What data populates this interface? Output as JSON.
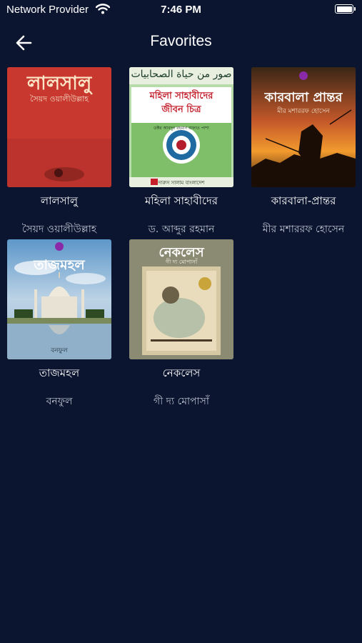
{
  "status_bar": {
    "carrier": "Network Provider",
    "time": "7:46 PM"
  },
  "header": {
    "title": "Favorites"
  },
  "books": [
    {
      "title": "লালসালু",
      "author": "সৈয়দ ওয়ালীউল্লাহ",
      "cover": {
        "title": "লালসালু",
        "subtitle": "সৈয়দ ওয়ালীউল্লাহ"
      }
    },
    {
      "title": "মহিলা সাহাবীদের",
      "author": "ড. আব্দুর রহমান",
      "cover": {
        "arabic": "صور من حياة الصحابيات",
        "title_line1": "মহিলা সাহাবীদের",
        "title_line2": "জীবন চিত্র",
        "author_line": "ডক্টর আবদুর রহমান রাফাত পাশা",
        "publisher": "দারুস সালাম বাংলাদেশ"
      }
    },
    {
      "title": "কারবালা-প্রান্তর",
      "author": "মীর মশাররফ হোসেন",
      "cover": {
        "title": "কারবালা প্রান্তর",
        "subtitle": "মীর মশাররফ হোসেন"
      }
    },
    {
      "title": "তাজমহল",
      "author": "বনফুল",
      "cover": {
        "title": "তাজমহল",
        "subtitle": "বনফুল"
      }
    },
    {
      "title": "নেকলেস",
      "author": "গী দ্য মোপাসাঁ",
      "cover": {
        "title": "নেকলেস",
        "subtitle": "গী দ্য মোপাসাঁ"
      }
    }
  ]
}
